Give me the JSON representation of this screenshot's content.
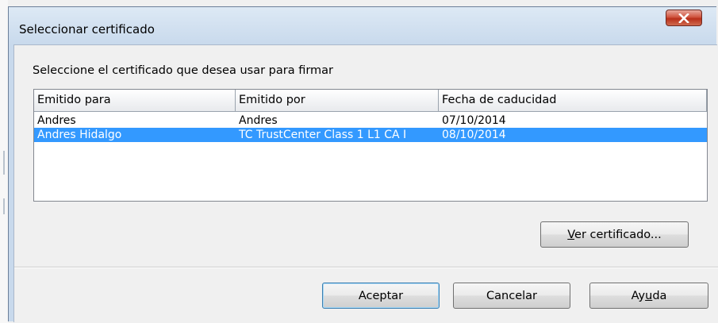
{
  "window": {
    "title": "Seleccionar certificado",
    "close_icon": "close-icon"
  },
  "dialog": {
    "prompt": "Seleccione el certificado que desea usar para firmar",
    "columns": [
      "Emitido para",
      "Emitido por",
      "Fecha de caducidad"
    ],
    "rows": [
      {
        "issued_to": "Andres",
        "issued_by": "Andres",
        "expiry": "07/10/2014",
        "selected": false
      },
      {
        "issued_to": "Andres Hidalgo",
        "issued_by": "TC TrustCenter Class 1 L1 CA I",
        "expiry": "08/10/2014",
        "selected": true
      }
    ],
    "selection_color": "#3399ff"
  },
  "buttons": {
    "view_cert": {
      "pre": "",
      "mnemonic": "V",
      "post": "er certificado..."
    },
    "accept": "Aceptar",
    "cancel": "Cancelar",
    "help": {
      "pre": "Ay",
      "mnemonic": "u",
      "post": "da"
    }
  }
}
